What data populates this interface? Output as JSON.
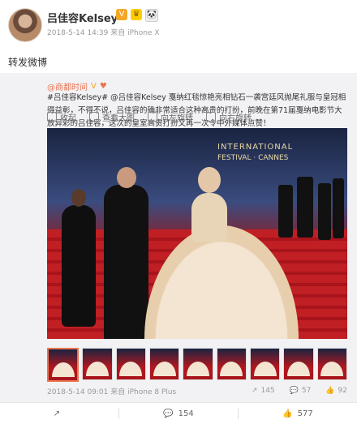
{
  "header": {
    "username": "吕佳容Kelsey",
    "meta": "2018-5-14 14:39 来自 iPhone X",
    "badges": [
      "vip-badge",
      "crown-badge",
      "panda-badge"
    ]
  },
  "repost": {
    "text": "转发微博"
  },
  "original": {
    "author": "@商都时间",
    "line_text": "#吕佳容Kelsey# @吕佳容Kelsey 戛纳红毯惊艳亮相钻石一袭宫廷风抛尾礼服与皇冠相得益彰，不得不说，吕佳容的确非常适合这种高贵的打扮，前晚在第71届戛纳电影节大放异彩的吕佳容，这次的皇室高贵打扮又再一次令中外媒体点赞！",
    "toolbar": {
      "collapse": "收起",
      "view_large": "查看大图",
      "rotate_left": "向左旋转",
      "rotate_right": "向右旋转"
    },
    "hero": {
      "festival_text": "INTERNATIONAL",
      "festival_text2": "FESTIVAL · CANNES"
    },
    "thumbnails_count": 9,
    "stats": {
      "time": "2018-5-14 09:01 来自 iPhone 8 Plus",
      "share": "145",
      "comment": "57",
      "like": "92"
    }
  },
  "bottom": {
    "share": "",
    "comment": "154",
    "like": "577"
  },
  "colors": {
    "link": "#eb7350",
    "bg": "#f2f2f5"
  }
}
